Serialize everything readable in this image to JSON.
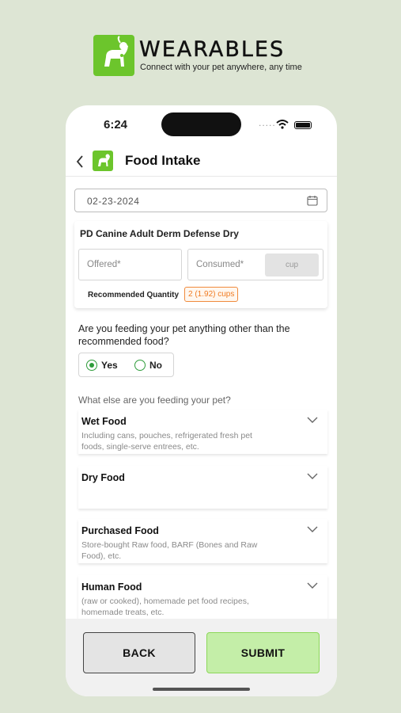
{
  "brand": {
    "name": "WEARABLES",
    "tagline": "Connect with your pet anywhere, any time"
  },
  "status_bar": {
    "time": "6:24",
    "dots": "....."
  },
  "header": {
    "title": "Food Intake"
  },
  "date_field": {
    "value": "02-23-2024"
  },
  "food_card": {
    "title": "PD Canine Adult Derm Defense Dry",
    "offered_placeholder": "Offered*",
    "consumed_placeholder": "Consumed*",
    "unit": "cup",
    "recommended_label": "Recommended Quantity",
    "recommended_value": "2 (1.92) cups"
  },
  "other_food": {
    "question": "Are you feeding your pet anything other than the recommended food?",
    "options": [
      {
        "label": "Yes",
        "selected": true
      },
      {
        "label": "No",
        "selected": false
      }
    ]
  },
  "what_else": {
    "label": "What else are you feeding your pet?"
  },
  "categories": [
    {
      "title": "Wet Food",
      "desc": "Including cans, pouches, refrigerated fresh pet foods, single-serve entrees, etc."
    },
    {
      "title": "Dry Food",
      "desc": ""
    },
    {
      "title": "Purchased Food",
      "desc": "Store-bought Raw food, BARF (Bones and Raw Food), etc."
    },
    {
      "title": "Human Food",
      "desc": "(raw or cooked), homemade pet food recipes, homemade treats, etc."
    }
  ],
  "actions": {
    "back": "BACK",
    "submit": "SUBMIT"
  },
  "colors": {
    "brand_green": "#6cc52c",
    "submit_bg": "#c4eea8",
    "badge_orange": "#f07b22",
    "radio_green": "#2e9c3a",
    "background": "#dde5d4"
  }
}
